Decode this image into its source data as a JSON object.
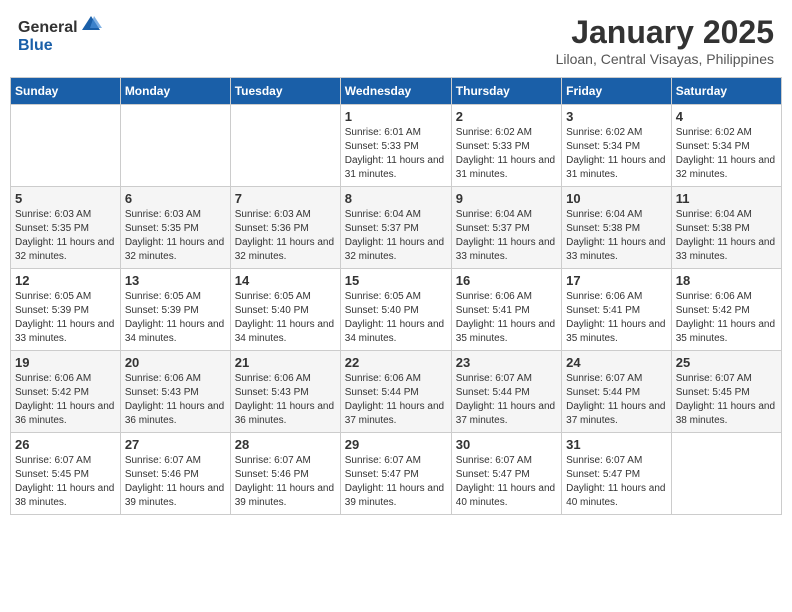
{
  "logo": {
    "general": "General",
    "blue": "Blue"
  },
  "header": {
    "month": "January 2025",
    "location": "Liloan, Central Visayas, Philippines"
  },
  "weekdays": [
    "Sunday",
    "Monday",
    "Tuesday",
    "Wednesday",
    "Thursday",
    "Friday",
    "Saturday"
  ],
  "weeks": [
    [
      {
        "day": "",
        "sunrise": "",
        "sunset": "",
        "daylight": ""
      },
      {
        "day": "",
        "sunrise": "",
        "sunset": "",
        "daylight": ""
      },
      {
        "day": "",
        "sunrise": "",
        "sunset": "",
        "daylight": ""
      },
      {
        "day": "1",
        "sunrise": "6:01 AM",
        "sunset": "5:33 PM",
        "daylight": "11 hours and 31 minutes."
      },
      {
        "day": "2",
        "sunrise": "6:02 AM",
        "sunset": "5:33 PM",
        "daylight": "11 hours and 31 minutes."
      },
      {
        "day": "3",
        "sunrise": "6:02 AM",
        "sunset": "5:34 PM",
        "daylight": "11 hours and 31 minutes."
      },
      {
        "day": "4",
        "sunrise": "6:02 AM",
        "sunset": "5:34 PM",
        "daylight": "11 hours and 32 minutes."
      }
    ],
    [
      {
        "day": "5",
        "sunrise": "6:03 AM",
        "sunset": "5:35 PM",
        "daylight": "11 hours and 32 minutes."
      },
      {
        "day": "6",
        "sunrise": "6:03 AM",
        "sunset": "5:35 PM",
        "daylight": "11 hours and 32 minutes."
      },
      {
        "day": "7",
        "sunrise": "6:03 AM",
        "sunset": "5:36 PM",
        "daylight": "11 hours and 32 minutes."
      },
      {
        "day": "8",
        "sunrise": "6:04 AM",
        "sunset": "5:37 PM",
        "daylight": "11 hours and 32 minutes."
      },
      {
        "day": "9",
        "sunrise": "6:04 AM",
        "sunset": "5:37 PM",
        "daylight": "11 hours and 33 minutes."
      },
      {
        "day": "10",
        "sunrise": "6:04 AM",
        "sunset": "5:38 PM",
        "daylight": "11 hours and 33 minutes."
      },
      {
        "day": "11",
        "sunrise": "6:04 AM",
        "sunset": "5:38 PM",
        "daylight": "11 hours and 33 minutes."
      }
    ],
    [
      {
        "day": "12",
        "sunrise": "6:05 AM",
        "sunset": "5:39 PM",
        "daylight": "11 hours and 33 minutes."
      },
      {
        "day": "13",
        "sunrise": "6:05 AM",
        "sunset": "5:39 PM",
        "daylight": "11 hours and 34 minutes."
      },
      {
        "day": "14",
        "sunrise": "6:05 AM",
        "sunset": "5:40 PM",
        "daylight": "11 hours and 34 minutes."
      },
      {
        "day": "15",
        "sunrise": "6:05 AM",
        "sunset": "5:40 PM",
        "daylight": "11 hours and 34 minutes."
      },
      {
        "day": "16",
        "sunrise": "6:06 AM",
        "sunset": "5:41 PM",
        "daylight": "11 hours and 35 minutes."
      },
      {
        "day": "17",
        "sunrise": "6:06 AM",
        "sunset": "5:41 PM",
        "daylight": "11 hours and 35 minutes."
      },
      {
        "day": "18",
        "sunrise": "6:06 AM",
        "sunset": "5:42 PM",
        "daylight": "11 hours and 35 minutes."
      }
    ],
    [
      {
        "day": "19",
        "sunrise": "6:06 AM",
        "sunset": "5:42 PM",
        "daylight": "11 hours and 36 minutes."
      },
      {
        "day": "20",
        "sunrise": "6:06 AM",
        "sunset": "5:43 PM",
        "daylight": "11 hours and 36 minutes."
      },
      {
        "day": "21",
        "sunrise": "6:06 AM",
        "sunset": "5:43 PM",
        "daylight": "11 hours and 36 minutes."
      },
      {
        "day": "22",
        "sunrise": "6:06 AM",
        "sunset": "5:44 PM",
        "daylight": "11 hours and 37 minutes."
      },
      {
        "day": "23",
        "sunrise": "6:07 AM",
        "sunset": "5:44 PM",
        "daylight": "11 hours and 37 minutes."
      },
      {
        "day": "24",
        "sunrise": "6:07 AM",
        "sunset": "5:44 PM",
        "daylight": "11 hours and 37 minutes."
      },
      {
        "day": "25",
        "sunrise": "6:07 AM",
        "sunset": "5:45 PM",
        "daylight": "11 hours and 38 minutes."
      }
    ],
    [
      {
        "day": "26",
        "sunrise": "6:07 AM",
        "sunset": "5:45 PM",
        "daylight": "11 hours and 38 minutes."
      },
      {
        "day": "27",
        "sunrise": "6:07 AM",
        "sunset": "5:46 PM",
        "daylight": "11 hours and 39 minutes."
      },
      {
        "day": "28",
        "sunrise": "6:07 AM",
        "sunset": "5:46 PM",
        "daylight": "11 hours and 39 minutes."
      },
      {
        "day": "29",
        "sunrise": "6:07 AM",
        "sunset": "5:47 PM",
        "daylight": "11 hours and 39 minutes."
      },
      {
        "day": "30",
        "sunrise": "6:07 AM",
        "sunset": "5:47 PM",
        "daylight": "11 hours and 40 minutes."
      },
      {
        "day": "31",
        "sunrise": "6:07 AM",
        "sunset": "5:47 PM",
        "daylight": "11 hours and 40 minutes."
      },
      {
        "day": "",
        "sunrise": "",
        "sunset": "",
        "daylight": ""
      }
    ]
  ]
}
